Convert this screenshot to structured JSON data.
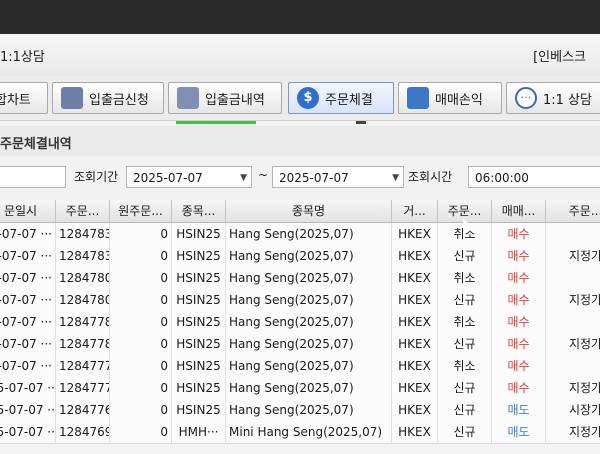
{
  "window": {
    "title": "1:1상담",
    "title_right": "[인베스크"
  },
  "toolbar": [
    {
      "label": "합차트",
      "icon": "chart-icon"
    },
    {
      "label": "입출금신청",
      "icon": "deposit-doc-icon"
    },
    {
      "label": "입출금내역",
      "icon": "history-doc-icon"
    },
    {
      "label": "주문체결",
      "icon": "coin-icon"
    },
    {
      "label": "매매손익",
      "icon": "wave-chart-icon"
    },
    {
      "label": "1:1 상담",
      "icon": "chat-icon"
    }
  ],
  "section": {
    "title": "주문체결내역"
  },
  "query": {
    "period_label": "조회기간",
    "start": "2025-07-07",
    "tilde": "~",
    "end": "2025-07-07",
    "time_label": "조회시간",
    "time": "06:00:00"
  },
  "table": {
    "headers": [
      "문일시",
      "주문...",
      "원주문...",
      "종목...",
      "종목명",
      "거...",
      "주문...",
      "매매...",
      "주문..."
    ],
    "rows": [
      [
        "-07-07 ···",
        "1284783",
        "0",
        "HSIN25",
        "Hang Seng(2025,07)",
        "HKEX",
        "취소",
        "매수",
        ""
      ],
      [
        "-07-07 ···",
        "1284783",
        "0",
        "HSIN25",
        "Hang Seng(2025,07)",
        "HKEX",
        "신규",
        "매수",
        "지정가"
      ],
      [
        "-07-07 ···",
        "1284780",
        "0",
        "HSIN25",
        "Hang Seng(2025,07)",
        "HKEX",
        "취소",
        "매수",
        ""
      ],
      [
        "-07-07 ···",
        "1284780",
        "0",
        "HSIN25",
        "Hang Seng(2025,07)",
        "HKEX",
        "신규",
        "매수",
        "지정가"
      ],
      [
        "5-07-07 ···",
        "1284778",
        "0",
        "HSIN25",
        "Hang Seng(2025,07)",
        "HKEX",
        "취소",
        "매수",
        ""
      ],
      [
        "5-07-07 ···",
        "1284778",
        "0",
        "HSIN25",
        "Hang Seng(2025,07)",
        "HKEX",
        "신규",
        "매수",
        "지정가"
      ],
      [
        "5-07-07 ···",
        "1284777",
        "0",
        "HSIN25",
        "Hang Seng(2025,07)",
        "HKEX",
        "취소",
        "매수",
        ""
      ],
      [
        "25-07-07 ···",
        "1284777",
        "0",
        "HSIN25",
        "Hang Seng(2025,07)",
        "HKEX",
        "신규",
        "매수",
        "지정가"
      ],
      [
        "25-07-07 ···",
        "1284776",
        "0",
        "HSIN25",
        "Hang Seng(2025,07)",
        "HKEX",
        "신규",
        "매도",
        "시장가"
      ],
      [
        "25-07-07 ···",
        "1284769",
        "0",
        "HMH···",
        "Mini Hang Seng(2025,07)",
        "HKEX",
        "신규",
        "매도",
        "지정가"
      ]
    ]
  },
  "colors": {
    "buy": "#e23b3b",
    "sell": "#3a7fd6"
  }
}
